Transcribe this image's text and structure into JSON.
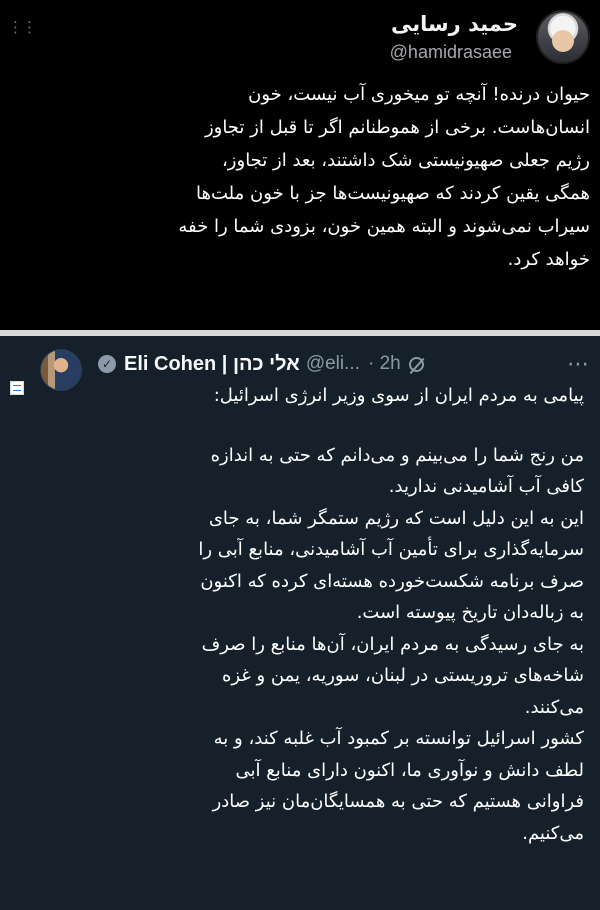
{
  "tweet1": {
    "name": "حمید رسایی",
    "handle": "@hamidrasaee",
    "more_icon": "more-horizontal-icon",
    "lines": [
      "حیوان درنده! آنچه تو میخوری آب نیست، خون",
      "انسان‌هاست. برخی از هموطنانم اگر تا قبل از تجاوز",
      "رژیم جعلی صهیونیستی شک داشتند، بعد از تجاوز،",
      "همگی یقین کردند که صهیونیست‌ها جز با خون ملت‌ها",
      "سیراب نمی‌شوند و البته همین خون، بزودی شما را خفه",
      "خواهد کرد."
    ]
  },
  "tweet2": {
    "name": "Eli Cohen | אלי כהן",
    "handle": "@eli...",
    "time": "· 2h",
    "verified_icon": "verified-badge-icon",
    "mute_icon": "mute-icon",
    "more_icon": "more-horizontal-icon",
    "flag_icon": "israel-flag-icon",
    "lines": [
      "پیامی به مردم ایران از سوی وزیر انرژی اسرائیل:",
      "",
      "من رنج شما را می‌بینم و می‌دانم که حتی به اندازه",
      "کافی آب آشامیدنی ندارید.",
      "این به این دلیل است که رژیم ستمگر شما، به جای",
      "سرمایه‌گذاری برای تأمین آب آشامیدنی، منابع آبی را",
      "صرف برنامه شکست‌خورده هسته‌ای کرده که اکنون",
      "به زباله‌دان تاریخ پیوسته است.",
      "به جای رسیدگی به مردم ایران، آن‌ها منابع را صرف",
      "شاخه‌های تروریستی در لبنان، سوریه، یمن و غزه",
      "می‌کنند.",
      "کشور اسرائیل توانسته بر کمبود آب غلبه کند، و به",
      "لطف دانش و نوآوری ما، اکنون دارای منابع آبی",
      "فراوانی هستیم که حتی به همسایگان‌مان نیز صادر",
      "می‌کنیم."
    ]
  }
}
